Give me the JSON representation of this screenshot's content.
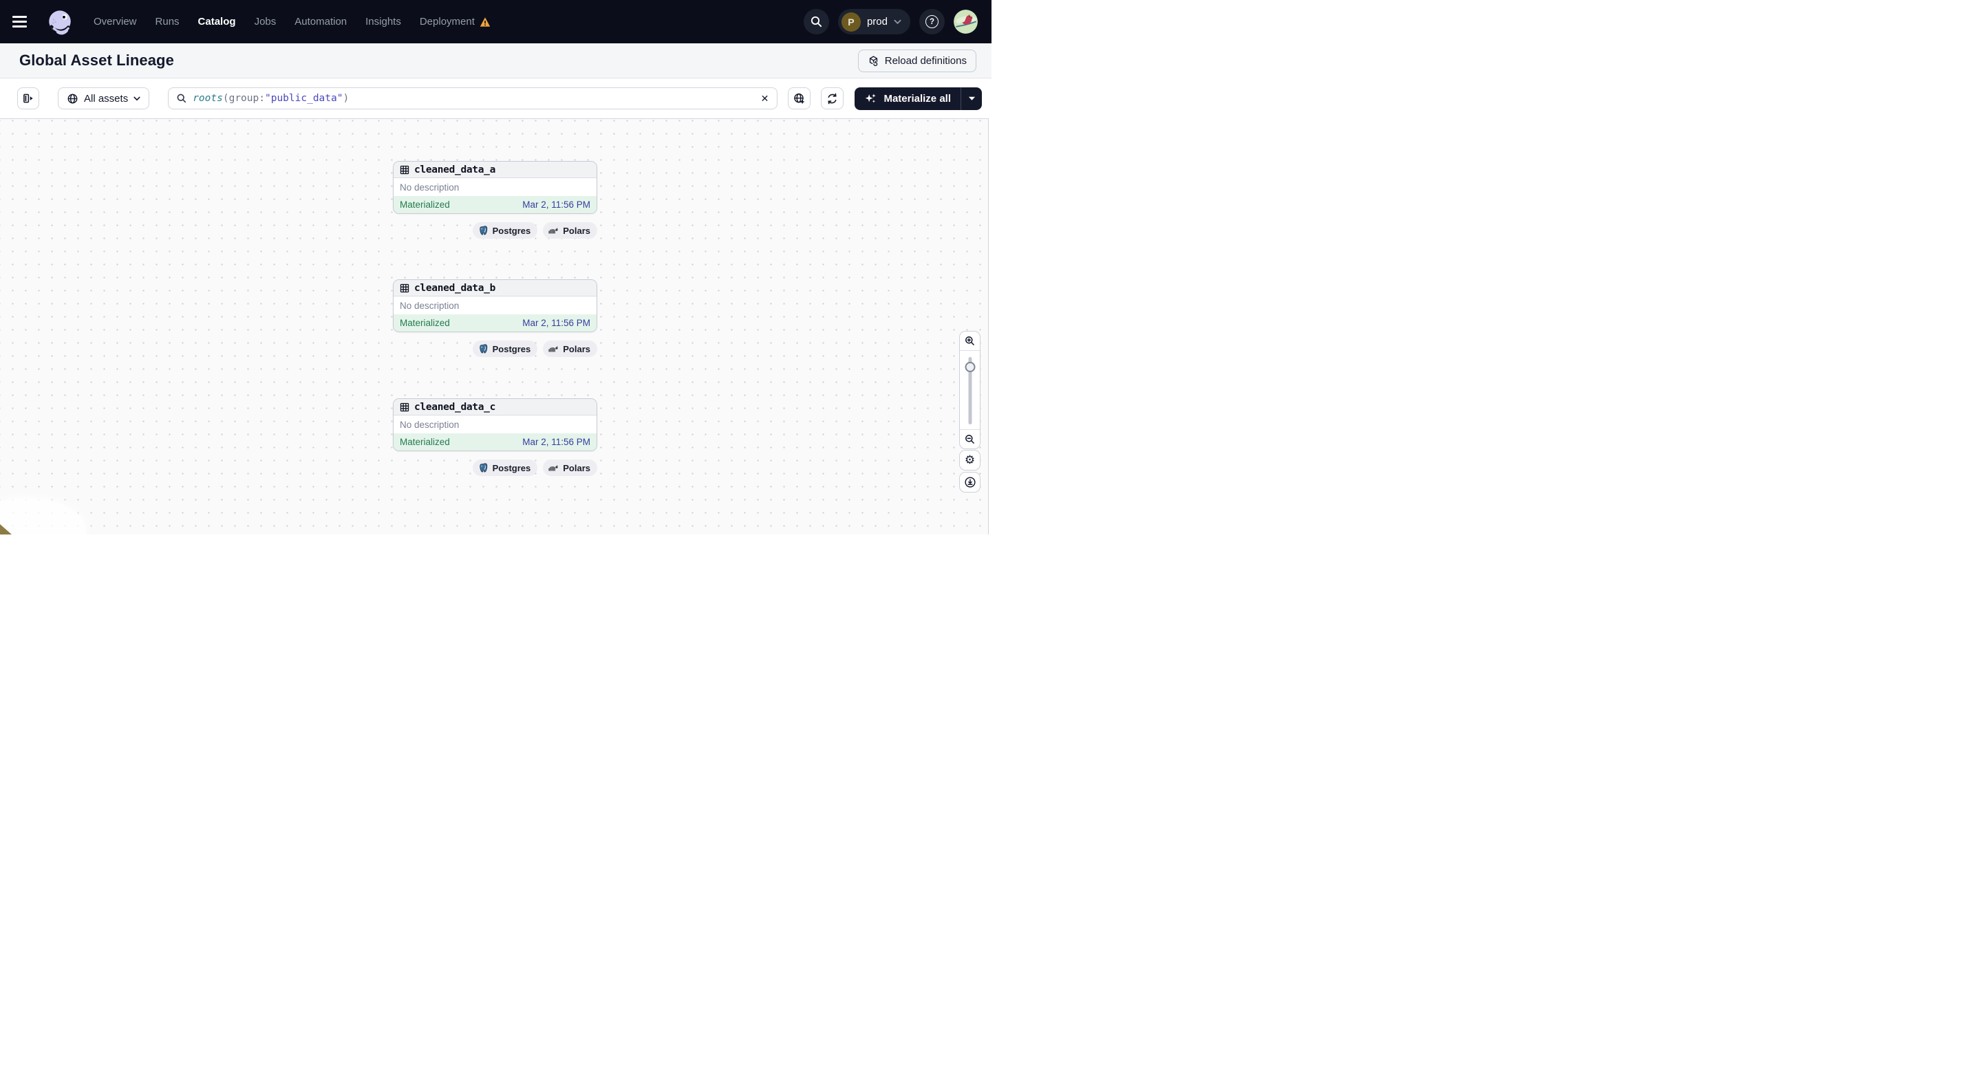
{
  "nav": {
    "items": [
      {
        "label": "Overview"
      },
      {
        "label": "Runs"
      },
      {
        "label": "Catalog"
      },
      {
        "label": "Jobs"
      },
      {
        "label": "Automation"
      },
      {
        "label": "Insights"
      },
      {
        "label": "Deployment"
      }
    ],
    "active_item": "Catalog",
    "environment": {
      "initial": "P",
      "name": "prod"
    }
  },
  "page": {
    "title": "Global Asset Lineage",
    "reload_label": "Reload definitions"
  },
  "toolbar": {
    "scope_label": "All assets",
    "search": {
      "fn": "roots",
      "punct_open": "(",
      "attr": "group:",
      "value": "\"public_data\"",
      "punct_close": ")"
    },
    "materialize_label": "Materialize all"
  },
  "canvas": {
    "nodes": [
      {
        "name": "cleaned_data_a",
        "description": "No description",
        "status": "Materialized",
        "timestamp": "Mar 2, 11:56 PM",
        "tags": [
          "Postgres",
          "Polars"
        ]
      },
      {
        "name": "cleaned_data_b",
        "description": "No description",
        "status": "Materialized",
        "timestamp": "Mar 2, 11:56 PM",
        "tags": [
          "Postgres",
          "Polars"
        ]
      },
      {
        "name": "cleaned_data_c",
        "description": "No description",
        "status": "Materialized",
        "timestamp": "Mar 2, 11:56 PM",
        "tags": [
          "Postgres",
          "Polars"
        ]
      }
    ]
  },
  "icons": {
    "help": "?",
    "clear": "✕",
    "gear": "⚙"
  },
  "colors": {
    "nav_bg": "#0b0e1a",
    "brand_lavender": "#cfcdf1",
    "status_green": "#247a4d",
    "status_green_bg": "#e4f4ea",
    "timestamp_indigo": "#363d9f",
    "warning_orange": "#f2a43c",
    "query_fn_teal": "#2a7d8c",
    "query_value_indigo": "#4a49bd"
  }
}
